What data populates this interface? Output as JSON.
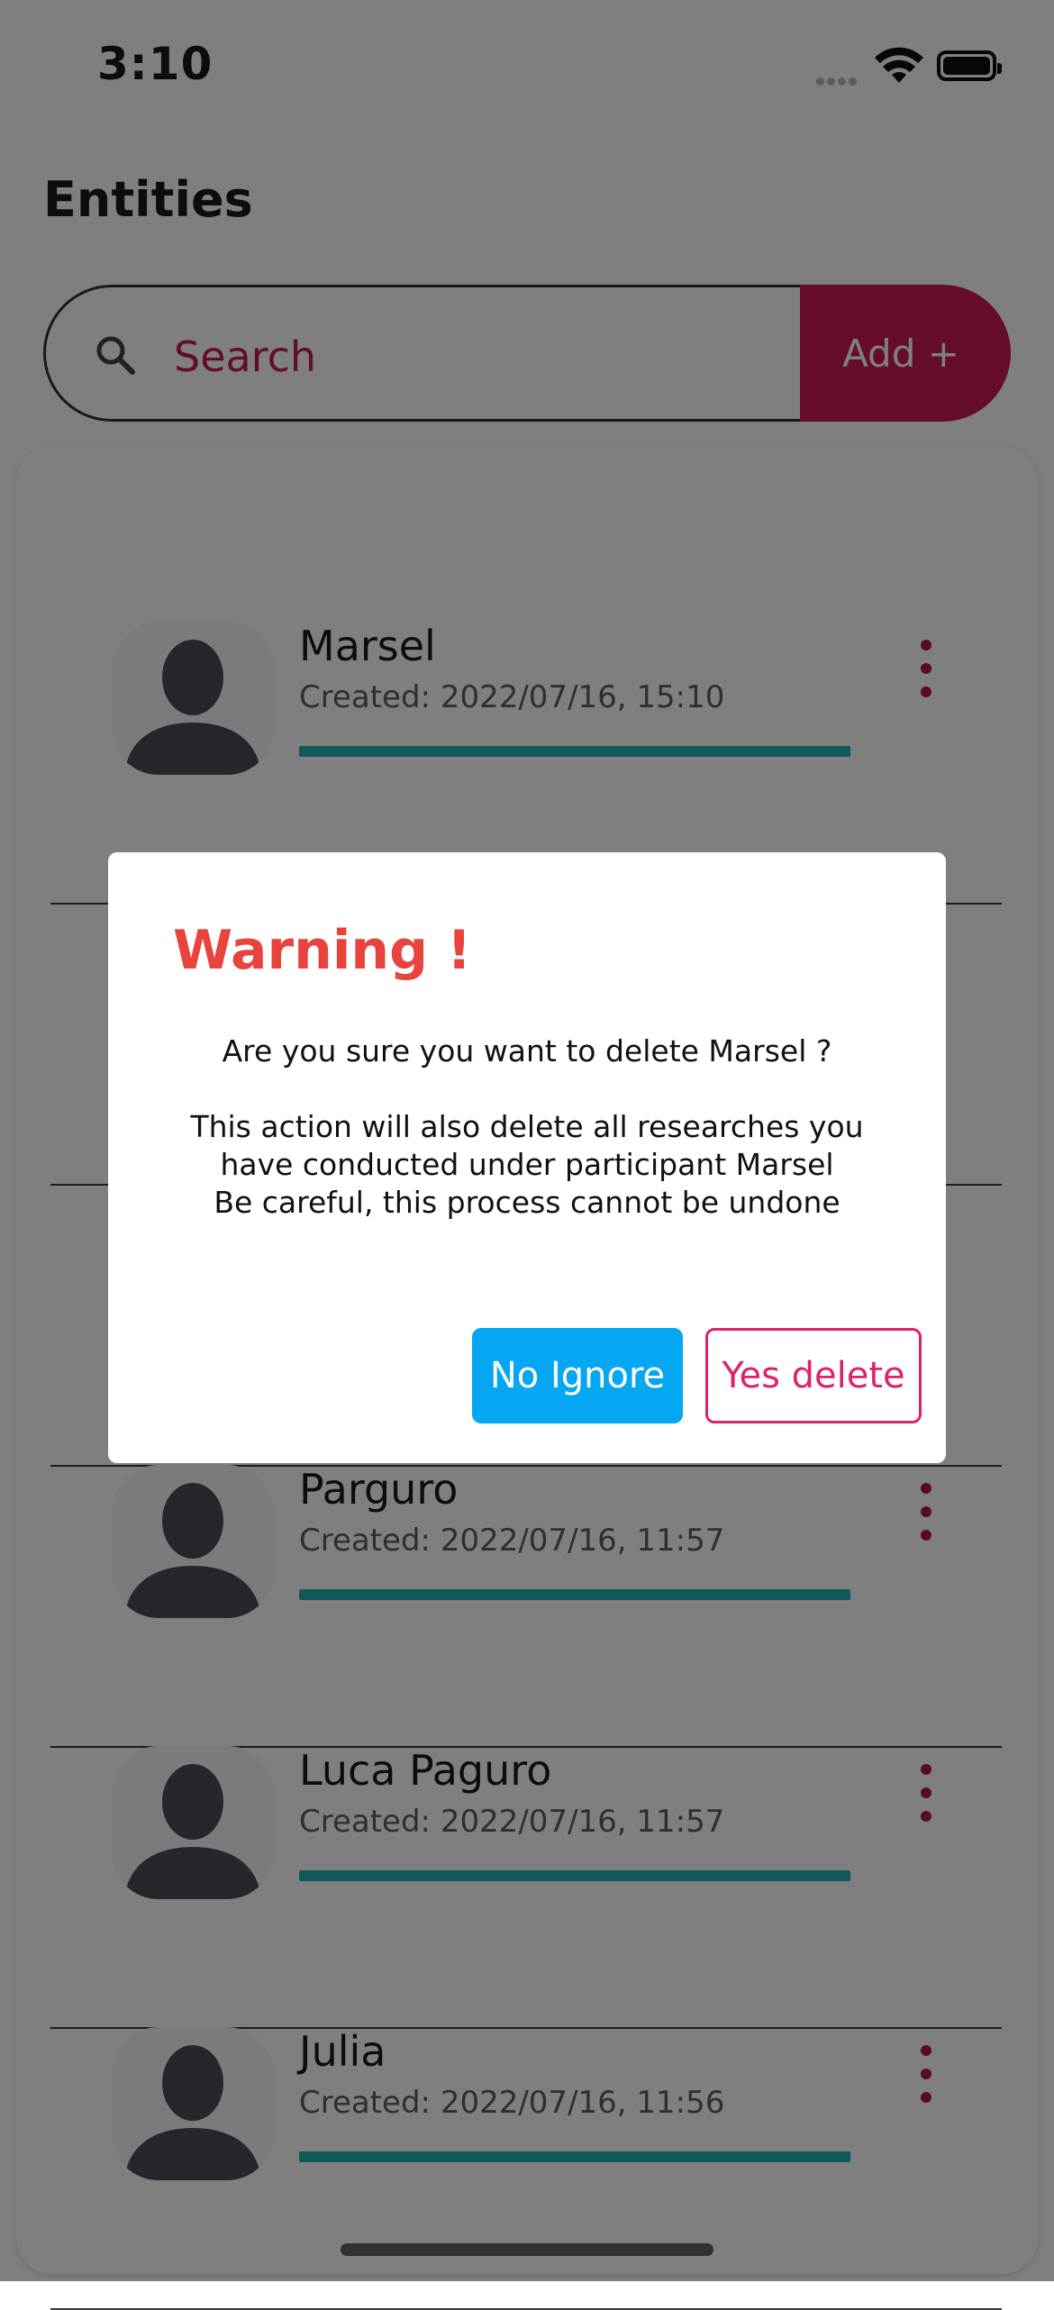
{
  "status_bar": {
    "time": "3:10"
  },
  "header": {
    "title": "Entities"
  },
  "search": {
    "placeholder": "Search",
    "add_label": "Add +"
  },
  "entities": [
    {
      "name": "Marsel",
      "created": "Created:  2022/07/16, 15:10"
    },
    {
      "name": "",
      "created": ""
    },
    {
      "name": "",
      "created": ""
    },
    {
      "name": "Parguro",
      "created": "Created:  2022/07/16, 11:57"
    },
    {
      "name": "Luca Paguro",
      "created": "Created:  2022/07/16, 11:57"
    },
    {
      "name": "Julia",
      "created": "Created:  2022/07/16, 11:56"
    }
  ],
  "dialog": {
    "title": "Warning !",
    "question": "Are you sure you want to delete  Marsel ?",
    "line1": "This action will also delete all researches you",
    "line2": "have conducted under participant Marsel",
    "line3": "Be careful, this process cannot be undone",
    "no_label": "No Ignore",
    "yes_label": "Yes delete"
  },
  "colors": {
    "accent": "#cc1a52",
    "warning": "#e8433d",
    "confirm_no": "#06a7f2",
    "progress": "#1fb3b2"
  },
  "icons": [
    "search-icon",
    "more-vert-icon",
    "avatar-silhouette-icon",
    "wifi-icon",
    "battery-icon"
  ]
}
